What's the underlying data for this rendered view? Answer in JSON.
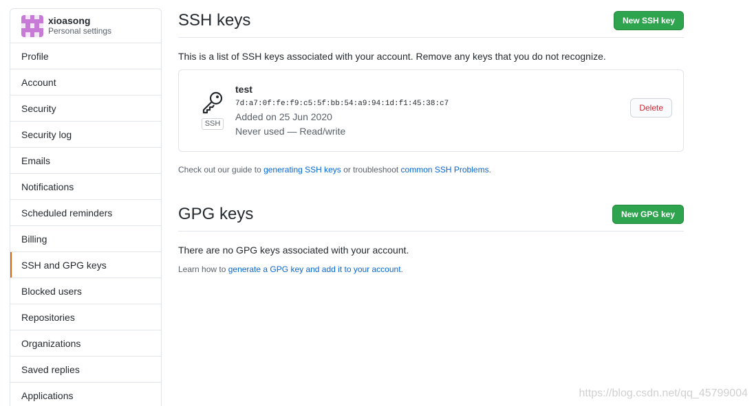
{
  "sidebar": {
    "username": "xioasong",
    "subtitle": "Personal settings",
    "items": [
      {
        "label": "Profile"
      },
      {
        "label": "Account"
      },
      {
        "label": "Security"
      },
      {
        "label": "Security log"
      },
      {
        "label": "Emails"
      },
      {
        "label": "Notifications"
      },
      {
        "label": "Scheduled reminders"
      },
      {
        "label": "Billing"
      },
      {
        "label": "SSH and GPG keys",
        "selected": true
      },
      {
        "label": "Blocked users"
      },
      {
        "label": "Repositories"
      },
      {
        "label": "Organizations"
      },
      {
        "label": "Saved replies"
      },
      {
        "label": "Applications"
      }
    ]
  },
  "ssh": {
    "title": "SSH keys",
    "new_button": "New SSH key",
    "description": "This is a list of SSH keys associated with your account. Remove any keys that you do not recognize.",
    "key": {
      "title": "test",
      "fingerprint": "7d:a7:0f:fe:f9:c5:5f:bb:54:a9:94:1d:f1:45:38:c7",
      "added": "Added on 25 Jun 2020",
      "usage": "Never used — Read/write",
      "badge": "SSH",
      "delete_label": "Delete"
    },
    "guide_prefix": "Check out our guide to ",
    "guide_link": "generating SSH keys",
    "guide_middle": " or troubleshoot ",
    "guide_link2": "common SSH Problems",
    "guide_suffix": "."
  },
  "gpg": {
    "title": "GPG keys",
    "new_button": "New GPG key",
    "empty_text": "There are no GPG keys associated with your account.",
    "learn_prefix": "Learn how to ",
    "learn_link": "generate a GPG key and add it to your account",
    "learn_suffix": "."
  },
  "watermark": "https://blog.csdn.net/qq_45799004",
  "colors": {
    "primary_green": "#2ea44f",
    "danger_red": "#cb2431",
    "link_blue": "#0366d6",
    "selected_marker": "#e36209"
  }
}
